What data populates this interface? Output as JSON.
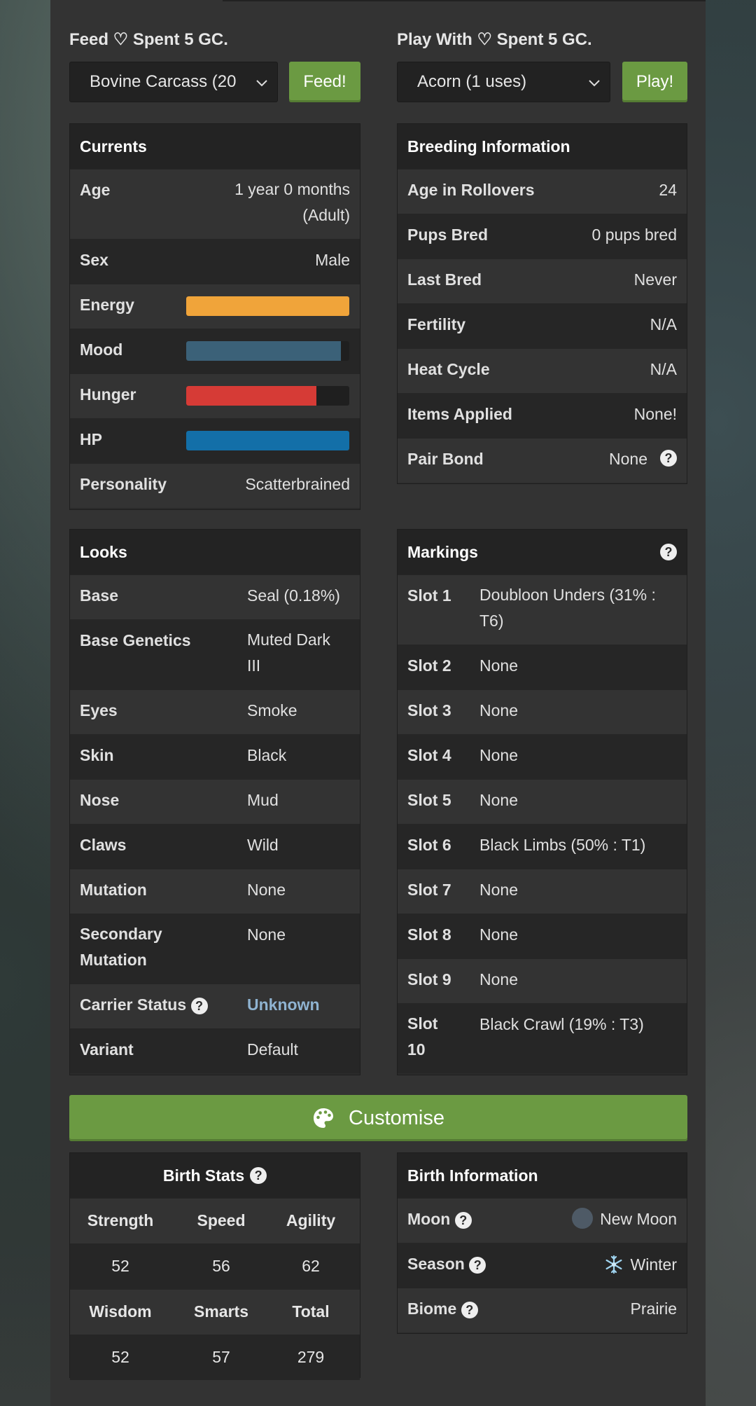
{
  "feed": {
    "label": "Feed ♡ Spent 5 GC.",
    "selected": "Bovine Carcass (20",
    "button": "Feed!"
  },
  "play": {
    "label": "Play With ♡ Spent 5 GC.",
    "selected": "Acorn (1 uses)",
    "button": "Play!"
  },
  "currents": {
    "title": "Currents",
    "age_label": "Age",
    "age_value_1": "1 year 0 months",
    "age_value_2": "(Adult)",
    "sex_label": "Sex",
    "sex_value": "Male",
    "energy_label": "Energy",
    "energy_level": 1.0,
    "energy_color": "#f0a43a",
    "mood_label": "Mood",
    "mood_level": 0.95,
    "mood_color": "#3b6178",
    "hunger_label": "Hunger",
    "hunger_level": 0.8,
    "hunger_color": "#d63b36",
    "hp_label": "HP",
    "hp_level": 1.0,
    "hp_color": "#136fa8",
    "personality_label": "Personality",
    "personality_value": "Scatterbrained"
  },
  "breeding": {
    "title": "Breeding Information",
    "rows": [
      {
        "label": "Age in Rollovers",
        "value": "24"
      },
      {
        "label": "Pups Bred",
        "value": "0 pups bred"
      },
      {
        "label": "Last Bred",
        "value": "Never"
      },
      {
        "label": "Fertility",
        "value": "N/A"
      },
      {
        "label": "Heat Cycle",
        "value": "N/A"
      },
      {
        "label": "Items Applied",
        "value": "None!"
      },
      {
        "label": "Pair Bond",
        "value": "None"
      }
    ],
    "help_icon": "question-circle-icon"
  },
  "looks": {
    "title": "Looks",
    "base_label": "Base",
    "base_value": "Seal (0.18%)",
    "genetics_label": "Base Genetics",
    "genetics_value_1": "Muted Dark",
    "genetics_value_2": "III",
    "eyes_label": "Eyes",
    "eyes_value": "Smoke",
    "skin_label": "Skin",
    "skin_value": "Black",
    "nose_label": "Nose",
    "nose_value": "Mud",
    "claws_label": "Claws",
    "claws_value": "Wild",
    "mutation_label": "Mutation",
    "mutation_value": "None",
    "secondary_label_1": "Secondary",
    "secondary_label_2": "Mutation",
    "secondary_value": "None",
    "carrier_label": "Carrier Status",
    "carrier_value": "Unknown",
    "variant_label": "Variant",
    "variant_value": "Default"
  },
  "markings": {
    "title": "Markings",
    "slot1_label": "Slot 1",
    "slot1_value_1": "Doubloon Unders (31% :",
    "slot1_value_2": "T6)",
    "slot2_label": "Slot 2",
    "slot2_value": "None",
    "slot3_label": "Slot 3",
    "slot3_value": "None",
    "slot4_label": "Slot 4",
    "slot4_value": "None",
    "slot5_label": "Slot 5",
    "slot5_value": "None",
    "slot6_label": "Slot 6",
    "slot6_value": "Black Limbs (50% : T1)",
    "slot7_label": "Slot 7",
    "slot7_value": "None",
    "slot8_label": "Slot 8",
    "slot8_value": "None",
    "slot9_label": "Slot 9",
    "slot9_value": "None",
    "slot10_label_1": "Slot",
    "slot10_label_2": "10",
    "slot10_value": "Black Crawl (19% : T3)"
  },
  "customise": {
    "label": "Customise",
    "icon": "palette-icon"
  },
  "birth_stats": {
    "title": "Birth Stats",
    "headers_1": [
      "Strength",
      "Speed",
      "Agility"
    ],
    "values_1": [
      "52",
      "56",
      "62"
    ],
    "headers_2": [
      "Wisdom",
      "Smarts",
      "Total"
    ],
    "values_2": [
      "52",
      "57",
      "279"
    ]
  },
  "birth_info": {
    "title": "Birth Information",
    "moon_label": "Moon",
    "moon_value": "New Moon",
    "season_label": "Season",
    "season_value": "Winter",
    "biome_label": "Biome",
    "biome_value": "Prairie"
  }
}
